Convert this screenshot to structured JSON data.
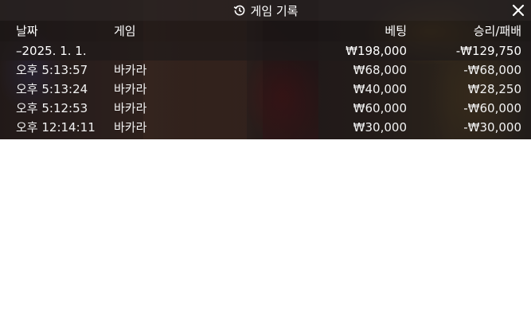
{
  "window": {
    "title": "게임 기록",
    "icon": "history-icon",
    "close_icon": "close-icon"
  },
  "columns": {
    "date": "날짜",
    "game": "게임",
    "bet": "베팅",
    "win_loss": "승리/패배"
  },
  "summary": {
    "date": "–2025. 1. 1.",
    "bet": "₩198,000",
    "win_loss": "-₩129,750"
  },
  "rows": [
    {
      "time": "오후 5:13:57",
      "game": "바카라",
      "bet": "₩68,000",
      "win_loss": "-₩68,000"
    },
    {
      "time": "오후 5:13:24",
      "game": "바카라",
      "bet": "₩40,000",
      "win_loss": "₩28,250"
    },
    {
      "time": "오후 5:12:53",
      "game": "바카라",
      "bet": "₩60,000",
      "win_loss": "-₩60,000"
    },
    {
      "time": "오후 12:14:11",
      "game": "바카라",
      "bet": "₩30,000",
      "win_loss": "-₩30,000"
    }
  ],
  "colors": {
    "text": "#ffffff",
    "panel_bg": "#2b211f"
  }
}
